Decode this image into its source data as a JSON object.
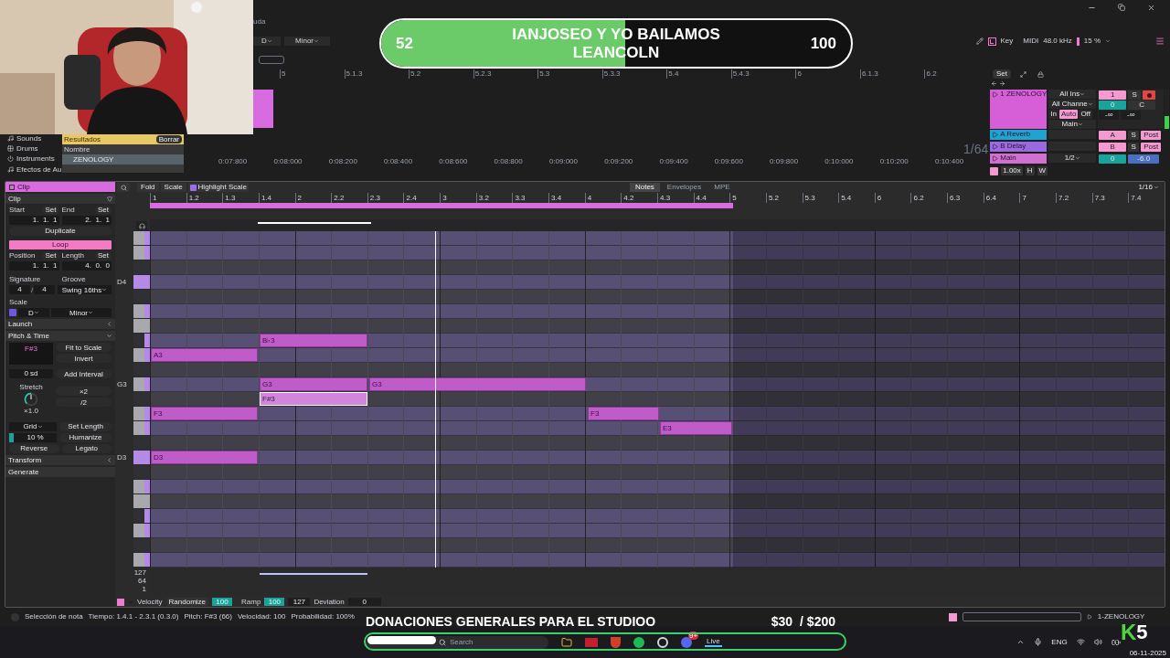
{
  "window": {
    "menu_fragment": "uda"
  },
  "top_bar": {
    "key": "D",
    "scale": "Minor",
    "key_label": "Key",
    "midi_label": "MIDI",
    "sample_rate": "48.0 kHz",
    "cpu": "15 %"
  },
  "arrangement_ruler": [
    "5",
    "5.1.3",
    "5.2",
    "5.2.3",
    "5.3",
    "5.3.3",
    "5.4",
    "5.4.3",
    "6",
    "6.1.3",
    "6.2"
  ],
  "set_button": "Set",
  "browser": {
    "categories": [
      {
        "label": "Sounds"
      },
      {
        "label": "Drums"
      },
      {
        "label": "Instruments"
      },
      {
        "label": "Efectos de Au"
      }
    ],
    "results": {
      "title": "Resultados",
      "clear": "Borrar",
      "column": "Nombre",
      "items": [
        {
          "name": "ZENOLOGY",
          "selected": true
        }
      ]
    }
  },
  "time_ruler": [
    "0:07:800",
    "0:08:000",
    "0:08:200",
    "0:08:400",
    "0:08:600",
    "0:08:800",
    "0:09:000",
    "0:09:200",
    "0:09:400",
    "0:09:600",
    "0:09:800",
    "0:10:000",
    "0:10:200",
    "0:10:400"
  ],
  "zoom_label": "1/64",
  "mixer": {
    "tracks": [
      {
        "name": "1 ZENOLOGY",
        "color": "#d65fd8"
      },
      {
        "name": "A Reverb",
        "color": "#1fa3d0"
      },
      {
        "name": "B Delay",
        "color": "#9b6ae0"
      },
      {
        "name": "Main",
        "color": "#d070d0"
      }
    ],
    "input": "All Ins",
    "channel": "All Channe",
    "monitor": [
      {
        "label": "In",
        "selected": false
      },
      {
        "label": "Auto",
        "selected": true
      },
      {
        "label": "Off",
        "selected": false
      }
    ],
    "output": "Main",
    "track_number": "1",
    "solo": "S",
    "volume": "0",
    "pan": "C",
    "peaks": [
      "-∞",
      "-∞"
    ],
    "returns": [
      {
        "send": "A",
        "solo": "S",
        "mode": "Post"
      },
      {
        "send": "B",
        "solo": "S",
        "mode": "Post"
      }
    ],
    "main": {
      "cue": "1/2",
      "volume": "0",
      "gain": "-6.0"
    },
    "tempo": "1.00x",
    "h": "H",
    "w": "W"
  },
  "clip_panel": {
    "title": "Clip",
    "section": "Clip",
    "start": {
      "label": "Start",
      "set": "Set",
      "value": "1.  1.  1"
    },
    "end": {
      "label": "End",
      "set": "Set",
      "value": "2.  1.  1"
    },
    "duplicate": "Duplicate",
    "loop": {
      "label": "Loop",
      "on": true
    },
    "position": {
      "label": "Position",
      "set": "Set",
      "value": "1.  1.  1"
    },
    "length": {
      "label": "Length",
      "set": "Set",
      "value": "4.  0.  0"
    },
    "signature": {
      "label": "Signature",
      "numerator": "4",
      "separator": "/",
      "denominator": "4"
    },
    "groove": {
      "label": "Groove",
      "value": "Swing 16ths"
    },
    "scale": {
      "label": "Scale",
      "on": true,
      "root": "D",
      "mode": "Minor"
    },
    "sections": [
      {
        "label": "Launch",
        "expanded": false
      },
      {
        "label": "Pitch & Time",
        "expanded": true
      }
    ],
    "pitch": {
      "note": "F#3",
      "fit": "Fit to Scale",
      "invert": "Invert",
      "semitones": "0 sd",
      "add_interval": "Add Interval",
      "stretch": {
        "label": "Stretch",
        "value": "×1.0"
      },
      "double": "×2",
      "half": "/2"
    },
    "grid": {
      "label": "Grid",
      "set_length": "Set Length",
      "humanize": "Humanize",
      "reverse": "Reverse",
      "legato": "Legato"
    },
    "humanize_amount": {
      "value": "10 %",
      "level": 0.1
    },
    "transform": {
      "label": "Transform",
      "expanded": false
    },
    "generate": "Generate"
  },
  "piano_roll": {
    "toolbar": {
      "fold": "Fold",
      "scale": "Scale",
      "highlight": {
        "label": "Highlight Scale",
        "checked": true
      },
      "tabs": [
        {
          "label": "Notes",
          "selected": true
        },
        {
          "label": "Envelopes",
          "selected": false
        },
        {
          "label": "MPE",
          "selected": false
        }
      ],
      "grid": "1/16"
    },
    "ruler": [
      "1",
      "1.2",
      "1.3",
      "1.4",
      "2",
      "2.2",
      "2.3",
      "2.4",
      "3",
      "3.2",
      "3.3",
      "3.4",
      "4",
      "4.2",
      "4.3",
      "4.4",
      "5",
      "5.2",
      "5.3",
      "5.4",
      "6",
      "6.2",
      "6.3",
      "6.4",
      "7",
      "7.2",
      "7.3",
      "7.4"
    ],
    "key_labels": [
      "D4",
      "G3",
      "D3"
    ],
    "notes": [
      {
        "label": "B♭3",
        "selected": false
      },
      {
        "label": "A3",
        "selected": false
      },
      {
        "label": "G3",
        "selected": false
      },
      {
        "label": "G3",
        "selected": false
      },
      {
        "label": "F#3",
        "selected": true
      },
      {
        "label": "F3",
        "selected": false
      },
      {
        "label": "F3",
        "selected": false
      },
      {
        "label": "E3",
        "selected": false
      },
      {
        "label": "D3",
        "selected": false
      }
    ],
    "velocity": {
      "ticks": [
        "127",
        "64",
        "1"
      ],
      "label": "Velocity",
      "randomize": "Randomize",
      "randomize_value": "100",
      "ramp": "Ramp",
      "ramp_value": "100",
      "ramp_end": "127",
      "deviation": "Deviation",
      "deviation_value": "0"
    }
  },
  "status_bar": {
    "items": [
      "Selección de nota",
      "Tiempo: 1.4.1 - 2.3.1 (0.3.0)",
      "Pitch: F#3 (66)",
      "Velocidad: 100",
      "Probabilidad: 100%"
    ],
    "track": "1-ZENOLOGY"
  },
  "stream_overlay": {
    "goal": {
      "current": "52",
      "title": "IANJOSEO Y YO BAILAMOS LEANCOLN",
      "target": "100",
      "level": 0.52
    },
    "donations": {
      "title": "DONACIONES GENERALES PARA EL STUDIOO",
      "raised": "$30",
      "goal": "/ $200"
    },
    "logo": {
      "letter": "K",
      "number": "5"
    }
  },
  "taskbar": {
    "search": "Search",
    "badge": "9+",
    "live": "Live",
    "language": "ENG",
    "date": "06-11-2025"
  }
}
